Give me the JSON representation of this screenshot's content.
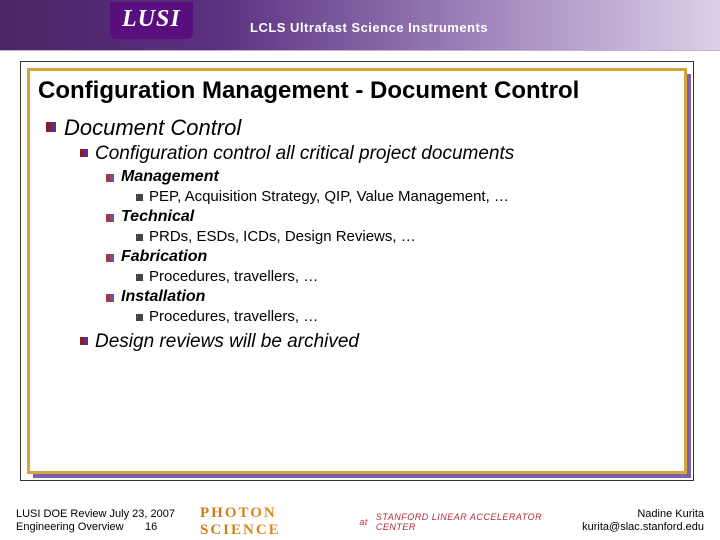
{
  "header": {
    "badge": "LUSI",
    "subtitle": "LCLS Ultrafast Science Instruments"
  },
  "title": "Configuration Management - Document Control",
  "bullets": {
    "l1a": "Document Control",
    "l2a": "Configuration control all critical project documents",
    "l3_mgmt": "Management",
    "l4_mgmt": "PEP, Acquisition Strategy, QIP, Value Management, …",
    "l3_tech": "Technical",
    "l4_tech": "PRDs, ESDs, ICDs, Design Reviews, …",
    "l3_fab": "Fabrication",
    "l4_fab": "Procedures, travellers, …",
    "l3_inst": "Installation",
    "l4_inst": "Procedures, travellers, …",
    "l2b": "Design reviews will be archived"
  },
  "footer": {
    "left_line1": "LUSI DOE Review July 23, 2007",
    "left_line2": "Engineering Overview",
    "page_no": "16",
    "center_brand": "PHOTON SCIENCE",
    "center_at": "at",
    "center_lab": "STANFORD LINEAR ACCELERATOR CENTER",
    "author": "Nadine Kurita",
    "email": "kurita@slac.stanford.edu"
  }
}
